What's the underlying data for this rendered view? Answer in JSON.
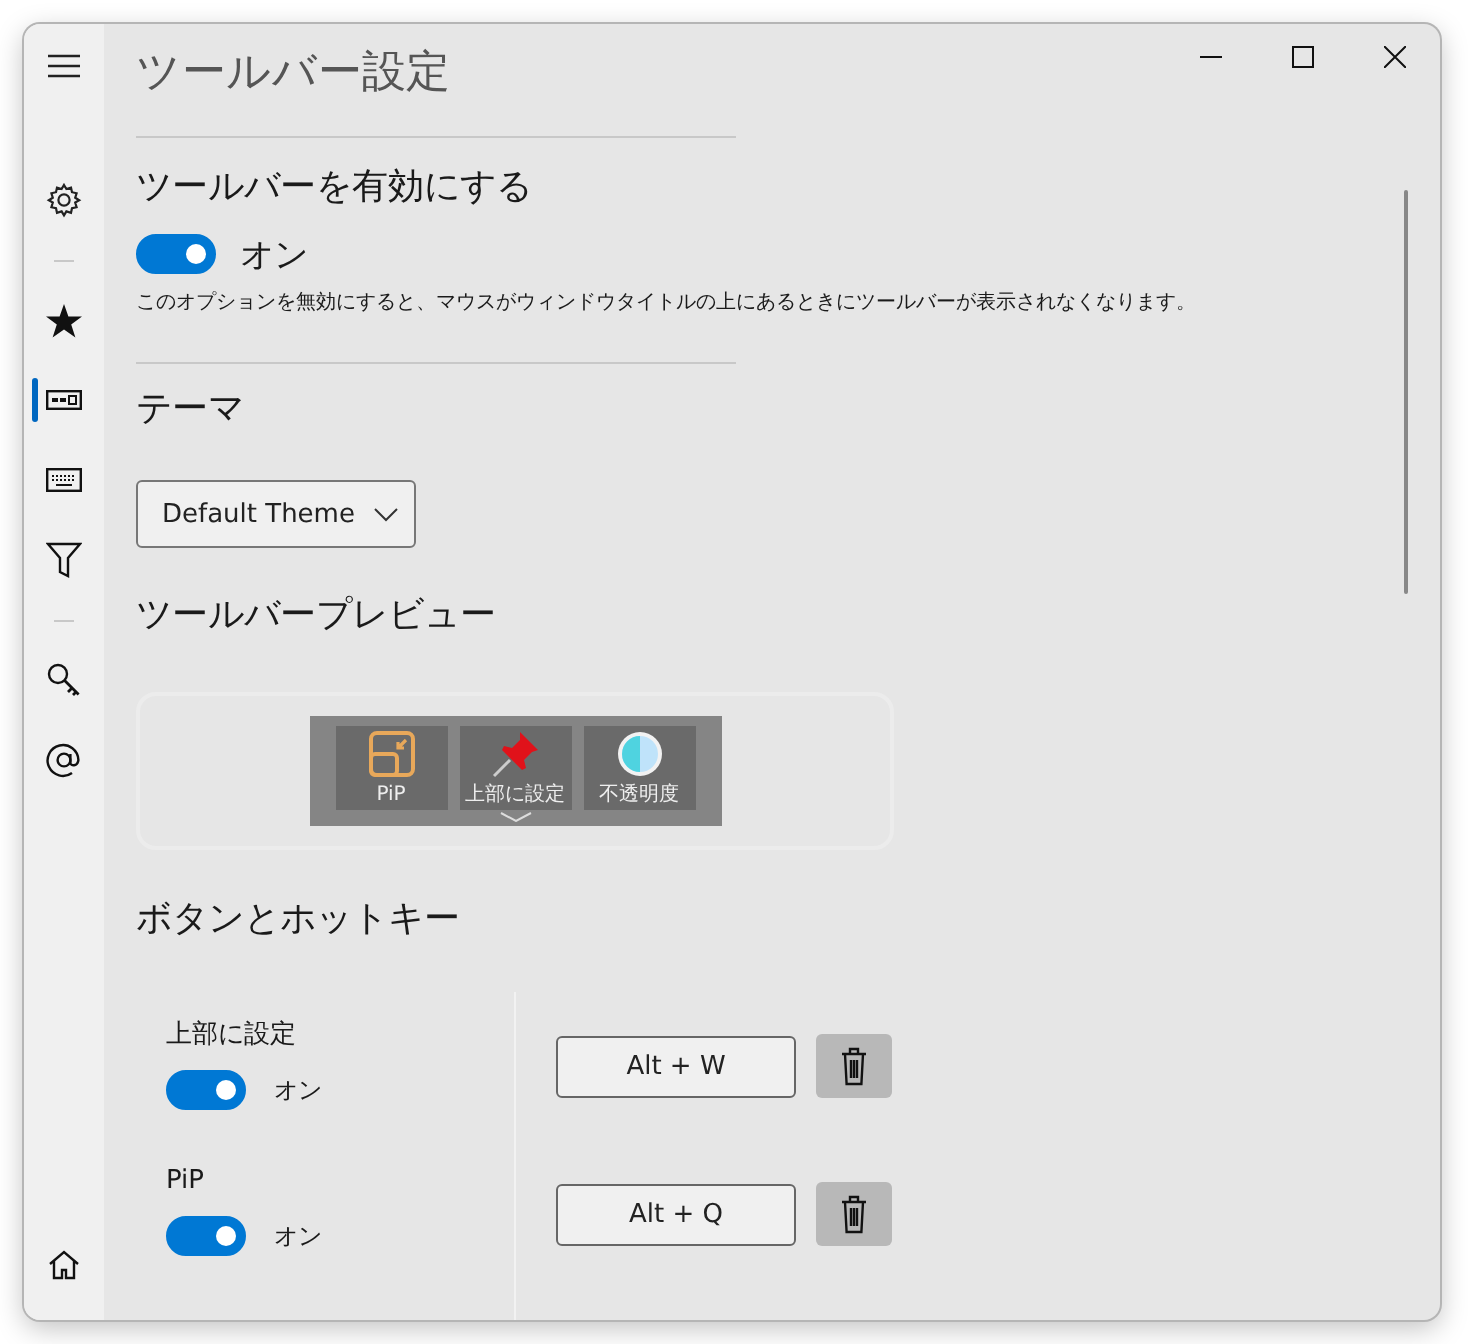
{
  "window": {
    "title": "ツールバー設定"
  },
  "sidebar": {
    "groups": [
      [
        {
          "kind": "gear",
          "selected": false
        }
      ],
      [
        {
          "kind": "star",
          "selected": false
        },
        {
          "kind": "toolbar",
          "selected": true
        },
        {
          "kind": "keyboard",
          "selected": false
        },
        {
          "kind": "filter",
          "selected": false
        }
      ],
      [
        {
          "kind": "key",
          "selected": false
        },
        {
          "kind": "at",
          "selected": false
        }
      ]
    ]
  },
  "enable_section": {
    "heading": "ツールバーを有効にする",
    "toggle": {
      "on": true,
      "label": "オン"
    },
    "description": "このオプションを無効にすると、マウスがウィンドウタイトルの上にあるときにツールバーが表示されなくなります。"
  },
  "theme_section": {
    "heading": "テーマ",
    "dropdown": {
      "value": "Default Theme"
    }
  },
  "preview_section": {
    "heading": "ツールバープレビュー",
    "buttons": [
      {
        "kind": "pip",
        "label": "PiP"
      },
      {
        "kind": "pin",
        "label": "上部に設定"
      },
      {
        "kind": "opacity",
        "label": "不透明度"
      }
    ]
  },
  "hotkey_section": {
    "heading": "ボタンとホットキー",
    "rows": [
      {
        "label": "上部に設定",
        "on": true,
        "state_label": "オン",
        "hotkey": "Alt + W"
      },
      {
        "label": "PiP",
        "on": true,
        "state_label": "オン",
        "hotkey": "Alt + Q"
      }
    ]
  }
}
